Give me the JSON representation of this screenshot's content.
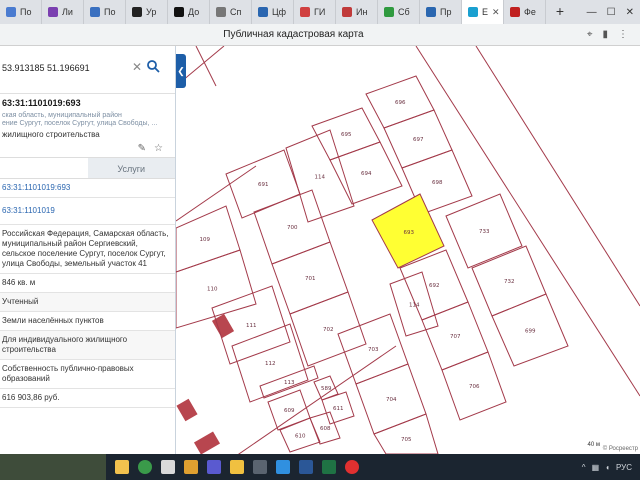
{
  "tabs": [
    {
      "label": "По"
    },
    {
      "label": "Ли"
    },
    {
      "label": "По"
    },
    {
      "label": "Ур"
    },
    {
      "label": "До"
    },
    {
      "label": "Сп"
    },
    {
      "label": "Цф"
    },
    {
      "label": "ГИ"
    },
    {
      "label": "Ин"
    },
    {
      "label": "Сб"
    },
    {
      "label": "Пр"
    },
    {
      "label": "Е"
    },
    {
      "label": "Фе"
    }
  ],
  "page_title": "Публичная кадастровая карта",
  "search": {
    "value": "53.913185 51.196691"
  },
  "parcel": {
    "cad_number": "63:31:1101019:693",
    "addr_line1": "ская область, муниципальный район",
    "addr_line2": "ение Сургут, поселок Сургут, улица Свободы, ...",
    "purpose_line": "жилищного строительства"
  },
  "panel_tabs": {
    "info": "",
    "services": "Услуги"
  },
  "details": {
    "link1": "63:31:1101019:693",
    "link2": "63:31:1101019",
    "address": "Российская Федерация, Самарская область, муниципальный район Сергиевский, сельское поселение Сургут, поселок Сургут, улица Свободы, земельный участок 41",
    "area": "846 кв. м",
    "status": "Учтенный",
    "category": "Земли населённых пунктов",
    "permitted_use": "Для индивидуального жилищного строительства",
    "ownership": "Собственность публично-правовых образований",
    "cad_value": "616 903,86 руб."
  },
  "map": {
    "plots": [
      "696",
      "695",
      "697",
      "694",
      "698",
      "691",
      "114",
      "693",
      "733",
      "109",
      "700",
      "692",
      "732",
      "110",
      "701",
      "114",
      "699",
      "111",
      "702",
      "707",
      "112",
      "703",
      "706",
      "704",
      "705",
      "113",
      "589",
      "611",
      "609",
      "610",
      "608"
    ],
    "scale": "40 м",
    "attribution": "© Росреестр"
  },
  "colors": {
    "selected_plot": "#ffff33",
    "plot_border": "#a33a4a",
    "accent": "#1d5ea8"
  }
}
